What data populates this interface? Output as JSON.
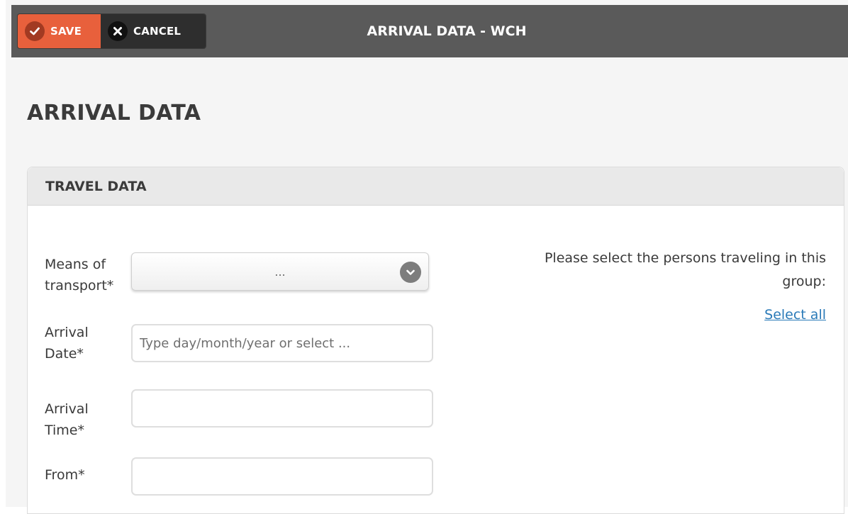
{
  "toolbar": {
    "save_label": "SAVE",
    "cancel_label": "CANCEL",
    "title": "ARRIVAL DATA - WCH"
  },
  "page": {
    "heading": "ARRIVAL DATA"
  },
  "travel_panel": {
    "header": "TRAVEL DATA",
    "means_of_transport": {
      "label_line1": "Means of",
      "label_line2": "transport*",
      "value": "..."
    },
    "arrival_date": {
      "label_line1": "Arrival",
      "label_line2": "Date*",
      "placeholder": "Type day/month/year or select ...",
      "value": ""
    },
    "arrival_time": {
      "label_line1": "Arrival",
      "label_line2": "Time*",
      "value": ""
    },
    "from": {
      "label": "From*",
      "value": ""
    },
    "persons_note_line1": "Please select the persons traveling in this",
    "persons_note_line2": "group:",
    "select_all_label": "Select all"
  },
  "colors": {
    "toolbar_bg": "#5a5a5a",
    "save_accent": "#e8603c",
    "cancel_bg": "#2e2e2e",
    "link": "#2a7ab8"
  },
  "icons": {
    "save": "check-circle-icon",
    "cancel": "close-icon",
    "select": "chevron-down-icon"
  }
}
